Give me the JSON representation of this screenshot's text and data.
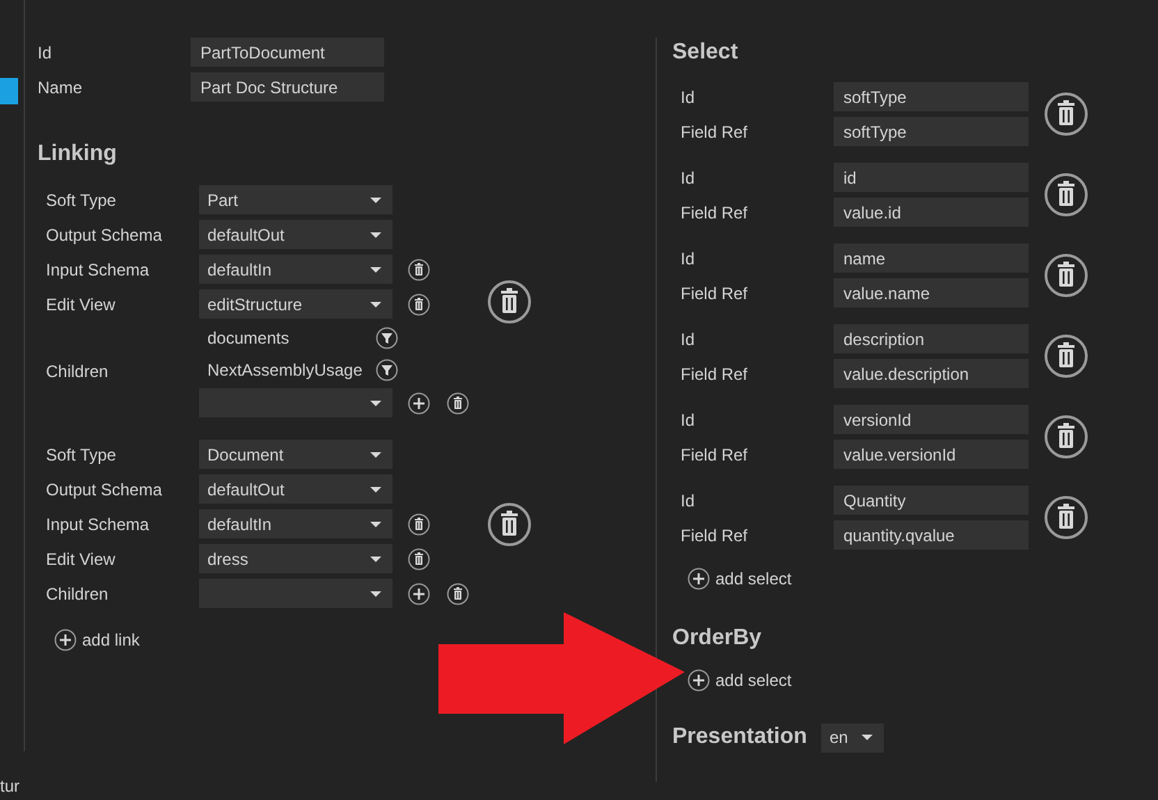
{
  "general": {
    "fields": [
      {
        "label": "Id",
        "value": "PartToDocument"
      },
      {
        "label": "Name",
        "value": "Part Doc Structure"
      }
    ]
  },
  "linking": {
    "title": "Linking",
    "links": [
      {
        "rows": [
          {
            "kind": "dropdown",
            "label": "Soft Type",
            "value": "Part",
            "deletable": false
          },
          {
            "kind": "dropdown",
            "label": "Output Schema",
            "value": "defaultOut",
            "deletable": false
          },
          {
            "kind": "dropdown",
            "label": "Input Schema",
            "value": "defaultIn",
            "deletable": true
          },
          {
            "kind": "dropdown",
            "label": "Edit View",
            "value": "editStructure",
            "deletable": true
          },
          {
            "kind": "children",
            "label": "Children",
            "items": [
              "documents",
              "NextAssemblyUsage"
            ]
          }
        ]
      },
      {
        "rows": [
          {
            "kind": "dropdown",
            "label": "Soft Type",
            "value": "Document",
            "deletable": false
          },
          {
            "kind": "dropdown",
            "label": "Output Schema",
            "value": "defaultOut",
            "deletable": false
          },
          {
            "kind": "dropdown",
            "label": "Input Schema",
            "value": "defaultIn",
            "deletable": true
          },
          {
            "kind": "dropdown",
            "label": "Edit View",
            "value": "dress",
            "deletable": true
          },
          {
            "kind": "children",
            "label": "Children"
          }
        ]
      }
    ],
    "add_label": "add link"
  },
  "select": {
    "title": "Select",
    "entries": [
      {
        "id_label": "Id",
        "id": "softType",
        "field_ref_label": "Field Ref",
        "field_ref": "softType"
      },
      {
        "id_label": "Id",
        "id": "id",
        "field_ref_label": "Field Ref",
        "field_ref": "value.id"
      },
      {
        "id_label": "Id",
        "id": "name",
        "field_ref_label": "Field Ref",
        "field_ref": "value.name"
      },
      {
        "id_label": "Id",
        "id": "description",
        "field_ref_label": "Field Ref",
        "field_ref": "value.description"
      },
      {
        "id_label": "Id",
        "id": "versionId",
        "field_ref_label": "Field Ref",
        "field_ref": "value.versionId"
      },
      {
        "id_label": "Id",
        "id": "Quantity",
        "field_ref_label": "Field Ref",
        "field_ref": "quantity.qvalue"
      }
    ],
    "add_label": "add select"
  },
  "order_by": {
    "title": "OrderBy",
    "add_label": "add select"
  },
  "presentation": {
    "title": "Presentation",
    "language": "en"
  },
  "sidebar": {
    "cut_label": "tur"
  }
}
